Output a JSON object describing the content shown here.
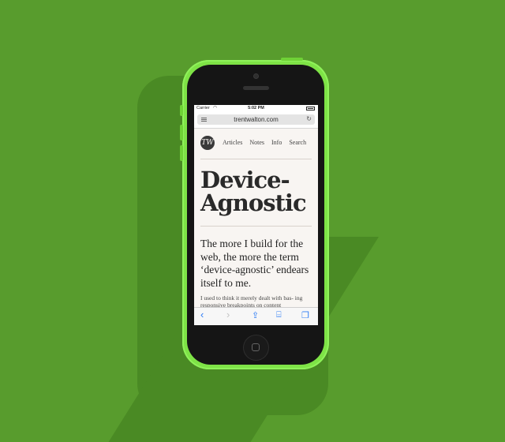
{
  "colors": {
    "background": "#589c2d",
    "phone_body": "#7ee346",
    "accent_blue": "#2f7df6"
  },
  "status_bar": {
    "carrier": "Carrier",
    "wifi_icon": "wifi-icon",
    "time": "5:02 PM",
    "battery_icon": "battery-icon"
  },
  "browser": {
    "url": "trentwalton.com",
    "menu_icon": "menu-icon",
    "reload_icon": "reload-icon",
    "toolbar": {
      "back_icon": "‹",
      "forward_icon": "›",
      "share_icon": "⇪",
      "bookmarks_icon": "⌸",
      "tabs_icon": "❐"
    }
  },
  "site": {
    "logo_text": "TW",
    "nav": [
      "Articles",
      "Notes",
      "Info",
      "Search"
    ],
    "headline_line1": "Device-",
    "headline_line2": "Agnostic",
    "intro": "The more I build for the web, the more the term ‘device-agnostic’ endears itself to me.",
    "body": "I used to think it merely dealt with bas- ing responsive breakpoints on content"
  }
}
